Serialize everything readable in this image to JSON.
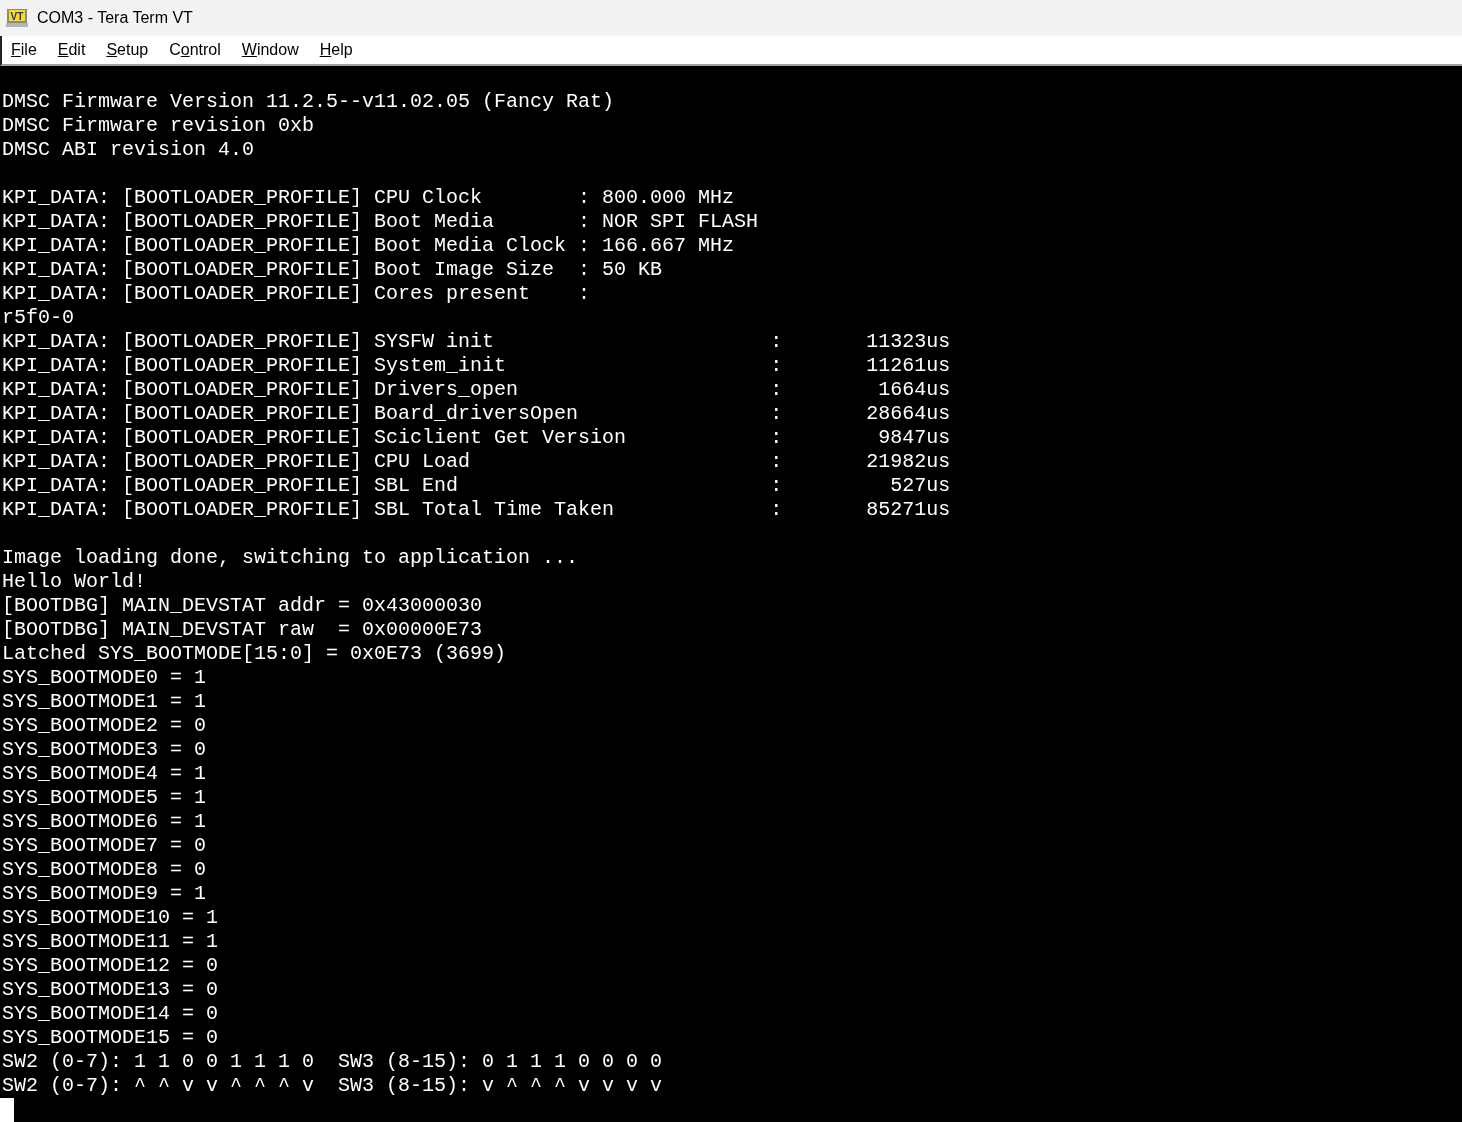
{
  "window": {
    "title": "COM3 - Tera Term VT",
    "icon_label": "VT"
  },
  "menu": [
    {
      "access_key": "F",
      "label_after": "ile"
    },
    {
      "access_key": "E",
      "label_after": "dit"
    },
    {
      "access_key": "S",
      "label_after": "etup"
    },
    {
      "label_before": "C",
      "access_key": "o",
      "label_after": "ntrol"
    },
    {
      "access_key": "W",
      "label_after": "indow"
    },
    {
      "access_key": "H",
      "label_after": "elp"
    }
  ],
  "terminal": {
    "blocks": [
      [
        "DMSC Firmware Version 11.2.5--v11.02.05 (Fancy Rat)",
        "DMSC Firmware revision 0xb",
        "DMSC ABI revision 4.0"
      ],
      [
        "KPI_DATA: [BOOTLOADER_PROFILE] CPU Clock        : 800.000 MHz",
        "KPI_DATA: [BOOTLOADER_PROFILE] Boot Media       : NOR SPI FLASH",
        "KPI_DATA: [BOOTLOADER_PROFILE] Boot Media Clock : 166.667 MHz",
        "KPI_DATA: [BOOTLOADER_PROFILE] Boot Image Size  : 50 KB",
        "KPI_DATA: [BOOTLOADER_PROFILE] Cores present    :",
        "r5f0-0",
        "KPI_DATA: [BOOTLOADER_PROFILE] SYSFW init                       :       11323us",
        "KPI_DATA: [BOOTLOADER_PROFILE] System_init                      :       11261us",
        "KPI_DATA: [BOOTLOADER_PROFILE] Drivers_open                     :        1664us",
        "KPI_DATA: [BOOTLOADER_PROFILE] Board_driversOpen                :       28664us",
        "KPI_DATA: [BOOTLOADER_PROFILE] Sciclient Get Version            :        9847us",
        "KPI_DATA: [BOOTLOADER_PROFILE] CPU Load                         :       21982us",
        "KPI_DATA: [BOOTLOADER_PROFILE] SBL End                          :         527us",
        "KPI_DATA: [BOOTLOADER_PROFILE] SBL Total Time Taken             :       85271us"
      ],
      [
        "Image loading done, switching to application ...",
        "Hello World!",
        "[BOOTDBG] MAIN_DEVSTAT addr = 0x43000030",
        "[BOOTDBG] MAIN_DEVSTAT raw  = 0x00000E73",
        "Latched SYS_BOOTMODE[15:0] = 0x0E73 (3699)",
        "SYS_BOOTMODE0 = 1",
        "SYS_BOOTMODE1 = 1",
        "SYS_BOOTMODE2 = 0",
        "SYS_BOOTMODE3 = 0",
        "SYS_BOOTMODE4 = 1",
        "SYS_BOOTMODE5 = 1",
        "SYS_BOOTMODE6 = 1",
        "SYS_BOOTMODE7 = 0",
        "SYS_BOOTMODE8 = 0",
        "SYS_BOOTMODE9 = 1",
        "SYS_BOOTMODE10 = 1",
        "SYS_BOOTMODE11 = 1",
        "SYS_BOOTMODE12 = 0",
        "SYS_BOOTMODE13 = 0",
        "SYS_BOOTMODE14 = 0",
        "SYS_BOOTMODE15 = 0",
        "SW2 (0-7): 1 1 0 0 1 1 1 0  SW3 (8-15): 0 1 1 1 0 0 0 0",
        "SW2 (0-7): ^ ^ v v ^ ^ ^ v  SW3 (8-15): v ^ ^ ^ v v v v"
      ]
    ]
  }
}
